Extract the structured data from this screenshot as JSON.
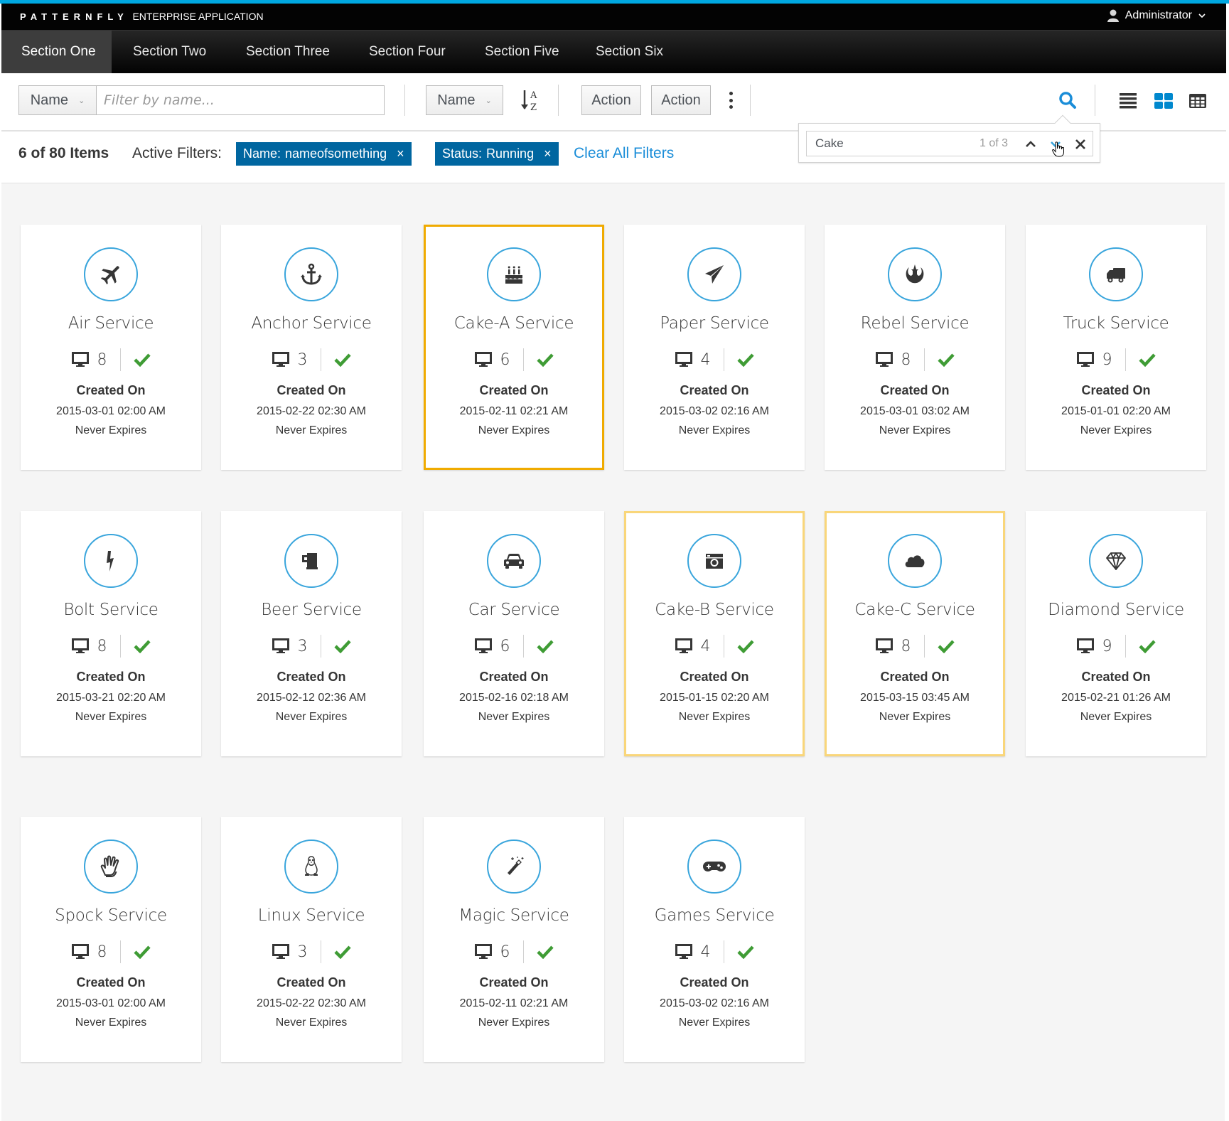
{
  "app": {
    "brand_logo": "PATTERNFLY",
    "brand_sub": "ENTERPRISE APPLICATION",
    "user_name": "Administrator"
  },
  "colors": {
    "accent_bar": "#00a8e1",
    "chip_bg": "#0066a0",
    "link": "#1a8dd8",
    "icon_circle": "#39a5dc",
    "status_ok": "#3f9c35",
    "match_current_border": "#f0ab00",
    "match_border": "#f9d67a"
  },
  "nav": {
    "tabs": [
      {
        "label": "Section One",
        "active": true
      },
      {
        "label": "Section Two",
        "active": false
      },
      {
        "label": "Section Three",
        "active": false
      },
      {
        "label": "Section Four",
        "active": false
      },
      {
        "label": "Section Five",
        "active": false
      },
      {
        "label": "Section Six",
        "active": false
      }
    ]
  },
  "toolbar": {
    "filter_field_label": "Name",
    "filter_placeholder": "Filter by name...",
    "sort_field_label": "Name",
    "sort_icon": "sort-alpha-asc-icon",
    "action1_label": "Action",
    "action2_label": "Action",
    "kebab_icon": "kebab-icon",
    "search_icon": "search-icon",
    "views": [
      {
        "name": "list-view-icon",
        "active": false
      },
      {
        "name": "card-view-icon",
        "active": true
      },
      {
        "name": "table-view-icon",
        "active": false
      }
    ]
  },
  "results": {
    "count_label": "6 of 80 Items",
    "active_filters_label": "Active Filters:",
    "filters": [
      {
        "field": "Name:",
        "value": "nameofsomething",
        "remove": "×"
      },
      {
        "field": "Status:",
        "value": "Running",
        "remove": "×"
      }
    ],
    "clear_all_label": "Clear All Filters"
  },
  "find": {
    "value": "Cake",
    "count": "1 of 3"
  },
  "cards": [
    {
      "title": "Air Service",
      "icon": "plane-icon",
      "count": "8",
      "created_label": "Created On",
      "created": "2015-03-01 02:00 AM",
      "expires": "Never Expires",
      "highlight": ""
    },
    {
      "title": "Anchor Service",
      "icon": "anchor-icon",
      "count": "3",
      "created_label": "Created On",
      "created": "2015-02-22 02:30 AM",
      "expires": "Never Expires",
      "highlight": ""
    },
    {
      "title": "Cake-A Service",
      "icon": "birthday-cake-icon",
      "count": "6",
      "created_label": "Created On",
      "created": "2015-02-11 02:21 AM",
      "expires": "Never Expires",
      "highlight": "current"
    },
    {
      "title": "Paper Service",
      "icon": "paper-plane-icon",
      "count": "4",
      "created_label": "Created On",
      "created": "2015-03-02 02:16 AM",
      "expires": "Never Expires",
      "highlight": ""
    },
    {
      "title": "Rebel Service",
      "icon": "rebel-icon",
      "count": "8",
      "created_label": "Created On",
      "created": "2015-03-01 03:02 AM",
      "expires": "Never Expires",
      "highlight": ""
    },
    {
      "title": "Truck Service",
      "icon": "truck-icon",
      "count": "9",
      "created_label": "Created On",
      "created": "2015-01-01 02:20 AM",
      "expires": "Never Expires",
      "highlight": ""
    },
    {
      "title": "Bolt Service",
      "icon": "bolt-icon",
      "count": "8",
      "created_label": "Created On",
      "created": "2015-03-21 02:20 AM",
      "expires": "Never Expires",
      "highlight": ""
    },
    {
      "title": "Beer Service",
      "icon": "beer-icon",
      "count": "3",
      "created_label": "Created On",
      "created": "2015-02-12 02:36 AM",
      "expires": "Never Expires",
      "highlight": ""
    },
    {
      "title": "Car Service",
      "icon": "car-icon",
      "count": "6",
      "created_label": "Created On",
      "created": "2015-02-16 02:18 AM",
      "expires": "Never Expires",
      "highlight": ""
    },
    {
      "title": "Cake-B Service",
      "icon": "camera-retro-icon",
      "count": "4",
      "created_label": "Created On",
      "created": "2015-01-15 02:20 AM",
      "expires": "Never Expires",
      "highlight": "match"
    },
    {
      "title": "Cake-C Service",
      "icon": "cloud-icon",
      "count": "8",
      "created_label": "Created On",
      "created": "2015-03-15 03:45 AM",
      "expires": "Never Expires",
      "highlight": "match"
    },
    {
      "title": "Diamond Service",
      "icon": "diamond-icon",
      "count": "9",
      "created_label": "Created On",
      "created": "2015-02-21 01:26 AM",
      "expires": "Never Expires",
      "highlight": ""
    },
    {
      "title": "Spock Service",
      "icon": "hand-spock-icon",
      "count": "8",
      "created_label": "Created On",
      "created": "2015-03-01 02:00 AM",
      "expires": "Never Expires",
      "highlight": ""
    },
    {
      "title": "Linux Service",
      "icon": "linux-icon",
      "count": "3",
      "created_label": "Created On",
      "created": "2015-02-22 02:30 AM",
      "expires": "Never Expires",
      "highlight": ""
    },
    {
      "title": "Magic Service",
      "icon": "magic-wand-icon",
      "count": "6",
      "created_label": "Created On",
      "created": "2015-02-11 02:21 AM",
      "expires": "Never Expires",
      "highlight": ""
    },
    {
      "title": "Games Service",
      "icon": "gamepad-icon",
      "count": "4",
      "created_label": "Created On",
      "created": "2015-03-02 02:16 AM",
      "expires": "Never Expires",
      "highlight": ""
    }
  ]
}
